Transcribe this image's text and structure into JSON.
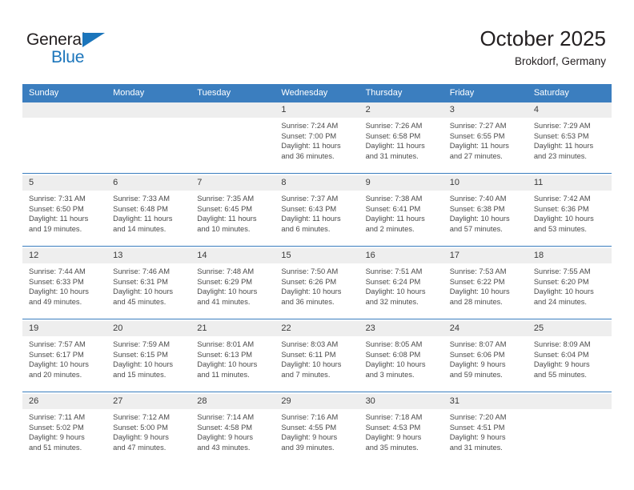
{
  "brand": {
    "name_part1": "General",
    "name_part2": "Blue",
    "accent_color": "#1b75bb"
  },
  "header": {
    "title": "October 2025",
    "subtitle": "Brokdorf, Germany"
  },
  "theme": {
    "header_blue": "#3b7ebf",
    "daynum_bg": "#eeeeee",
    "text": "#4a4a4a"
  },
  "weekday_headers": [
    "Sunday",
    "Monday",
    "Tuesday",
    "Wednesday",
    "Thursday",
    "Friday",
    "Saturday"
  ],
  "labels": {
    "sunrise": "Sunrise:",
    "sunset": "Sunset:",
    "daylight": "Daylight:"
  },
  "weeks": [
    [
      {
        "day": "",
        "sunrise": "",
        "sunset": "",
        "daylight1": "",
        "daylight2": ""
      },
      {
        "day": "",
        "sunrise": "",
        "sunset": "",
        "daylight1": "",
        "daylight2": ""
      },
      {
        "day": "",
        "sunrise": "",
        "sunset": "",
        "daylight1": "",
        "daylight2": ""
      },
      {
        "day": "1",
        "sunrise": "Sunrise: 7:24 AM",
        "sunset": "Sunset: 7:00 PM",
        "daylight1": "Daylight: 11 hours",
        "daylight2": "and 36 minutes."
      },
      {
        "day": "2",
        "sunrise": "Sunrise: 7:26 AM",
        "sunset": "Sunset: 6:58 PM",
        "daylight1": "Daylight: 11 hours",
        "daylight2": "and 31 minutes."
      },
      {
        "day": "3",
        "sunrise": "Sunrise: 7:27 AM",
        "sunset": "Sunset: 6:55 PM",
        "daylight1": "Daylight: 11 hours",
        "daylight2": "and 27 minutes."
      },
      {
        "day": "4",
        "sunrise": "Sunrise: 7:29 AM",
        "sunset": "Sunset: 6:53 PM",
        "daylight1": "Daylight: 11 hours",
        "daylight2": "and 23 minutes."
      }
    ],
    [
      {
        "day": "5",
        "sunrise": "Sunrise: 7:31 AM",
        "sunset": "Sunset: 6:50 PM",
        "daylight1": "Daylight: 11 hours",
        "daylight2": "and 19 minutes."
      },
      {
        "day": "6",
        "sunrise": "Sunrise: 7:33 AM",
        "sunset": "Sunset: 6:48 PM",
        "daylight1": "Daylight: 11 hours",
        "daylight2": "and 14 minutes."
      },
      {
        "day": "7",
        "sunrise": "Sunrise: 7:35 AM",
        "sunset": "Sunset: 6:45 PM",
        "daylight1": "Daylight: 11 hours",
        "daylight2": "and 10 minutes."
      },
      {
        "day": "8",
        "sunrise": "Sunrise: 7:37 AM",
        "sunset": "Sunset: 6:43 PM",
        "daylight1": "Daylight: 11 hours",
        "daylight2": "and 6 minutes."
      },
      {
        "day": "9",
        "sunrise": "Sunrise: 7:38 AM",
        "sunset": "Sunset: 6:41 PM",
        "daylight1": "Daylight: 11 hours",
        "daylight2": "and 2 minutes."
      },
      {
        "day": "10",
        "sunrise": "Sunrise: 7:40 AM",
        "sunset": "Sunset: 6:38 PM",
        "daylight1": "Daylight: 10 hours",
        "daylight2": "and 57 minutes."
      },
      {
        "day": "11",
        "sunrise": "Sunrise: 7:42 AM",
        "sunset": "Sunset: 6:36 PM",
        "daylight1": "Daylight: 10 hours",
        "daylight2": "and 53 minutes."
      }
    ],
    [
      {
        "day": "12",
        "sunrise": "Sunrise: 7:44 AM",
        "sunset": "Sunset: 6:33 PM",
        "daylight1": "Daylight: 10 hours",
        "daylight2": "and 49 minutes."
      },
      {
        "day": "13",
        "sunrise": "Sunrise: 7:46 AM",
        "sunset": "Sunset: 6:31 PM",
        "daylight1": "Daylight: 10 hours",
        "daylight2": "and 45 minutes."
      },
      {
        "day": "14",
        "sunrise": "Sunrise: 7:48 AM",
        "sunset": "Sunset: 6:29 PM",
        "daylight1": "Daylight: 10 hours",
        "daylight2": "and 41 minutes."
      },
      {
        "day": "15",
        "sunrise": "Sunrise: 7:50 AM",
        "sunset": "Sunset: 6:26 PM",
        "daylight1": "Daylight: 10 hours",
        "daylight2": "and 36 minutes."
      },
      {
        "day": "16",
        "sunrise": "Sunrise: 7:51 AM",
        "sunset": "Sunset: 6:24 PM",
        "daylight1": "Daylight: 10 hours",
        "daylight2": "and 32 minutes."
      },
      {
        "day": "17",
        "sunrise": "Sunrise: 7:53 AM",
        "sunset": "Sunset: 6:22 PM",
        "daylight1": "Daylight: 10 hours",
        "daylight2": "and 28 minutes."
      },
      {
        "day": "18",
        "sunrise": "Sunrise: 7:55 AM",
        "sunset": "Sunset: 6:20 PM",
        "daylight1": "Daylight: 10 hours",
        "daylight2": "and 24 minutes."
      }
    ],
    [
      {
        "day": "19",
        "sunrise": "Sunrise: 7:57 AM",
        "sunset": "Sunset: 6:17 PM",
        "daylight1": "Daylight: 10 hours",
        "daylight2": "and 20 minutes."
      },
      {
        "day": "20",
        "sunrise": "Sunrise: 7:59 AM",
        "sunset": "Sunset: 6:15 PM",
        "daylight1": "Daylight: 10 hours",
        "daylight2": "and 15 minutes."
      },
      {
        "day": "21",
        "sunrise": "Sunrise: 8:01 AM",
        "sunset": "Sunset: 6:13 PM",
        "daylight1": "Daylight: 10 hours",
        "daylight2": "and 11 minutes."
      },
      {
        "day": "22",
        "sunrise": "Sunrise: 8:03 AM",
        "sunset": "Sunset: 6:11 PM",
        "daylight1": "Daylight: 10 hours",
        "daylight2": "and 7 minutes."
      },
      {
        "day": "23",
        "sunrise": "Sunrise: 8:05 AM",
        "sunset": "Sunset: 6:08 PM",
        "daylight1": "Daylight: 10 hours",
        "daylight2": "and 3 minutes."
      },
      {
        "day": "24",
        "sunrise": "Sunrise: 8:07 AM",
        "sunset": "Sunset: 6:06 PM",
        "daylight1": "Daylight: 9 hours",
        "daylight2": "and 59 minutes."
      },
      {
        "day": "25",
        "sunrise": "Sunrise: 8:09 AM",
        "sunset": "Sunset: 6:04 PM",
        "daylight1": "Daylight: 9 hours",
        "daylight2": "and 55 minutes."
      }
    ],
    [
      {
        "day": "26",
        "sunrise": "Sunrise: 7:11 AM",
        "sunset": "Sunset: 5:02 PM",
        "daylight1": "Daylight: 9 hours",
        "daylight2": "and 51 minutes."
      },
      {
        "day": "27",
        "sunrise": "Sunrise: 7:12 AM",
        "sunset": "Sunset: 5:00 PM",
        "daylight1": "Daylight: 9 hours",
        "daylight2": "and 47 minutes."
      },
      {
        "day": "28",
        "sunrise": "Sunrise: 7:14 AM",
        "sunset": "Sunset: 4:58 PM",
        "daylight1": "Daylight: 9 hours",
        "daylight2": "and 43 minutes."
      },
      {
        "day": "29",
        "sunrise": "Sunrise: 7:16 AM",
        "sunset": "Sunset: 4:55 PM",
        "daylight1": "Daylight: 9 hours",
        "daylight2": "and 39 minutes."
      },
      {
        "day": "30",
        "sunrise": "Sunrise: 7:18 AM",
        "sunset": "Sunset: 4:53 PM",
        "daylight1": "Daylight: 9 hours",
        "daylight2": "and 35 minutes."
      },
      {
        "day": "31",
        "sunrise": "Sunrise: 7:20 AM",
        "sunset": "Sunset: 4:51 PM",
        "daylight1": "Daylight: 9 hours",
        "daylight2": "and 31 minutes."
      },
      {
        "day": "",
        "sunrise": "",
        "sunset": "",
        "daylight1": "",
        "daylight2": ""
      }
    ]
  ]
}
